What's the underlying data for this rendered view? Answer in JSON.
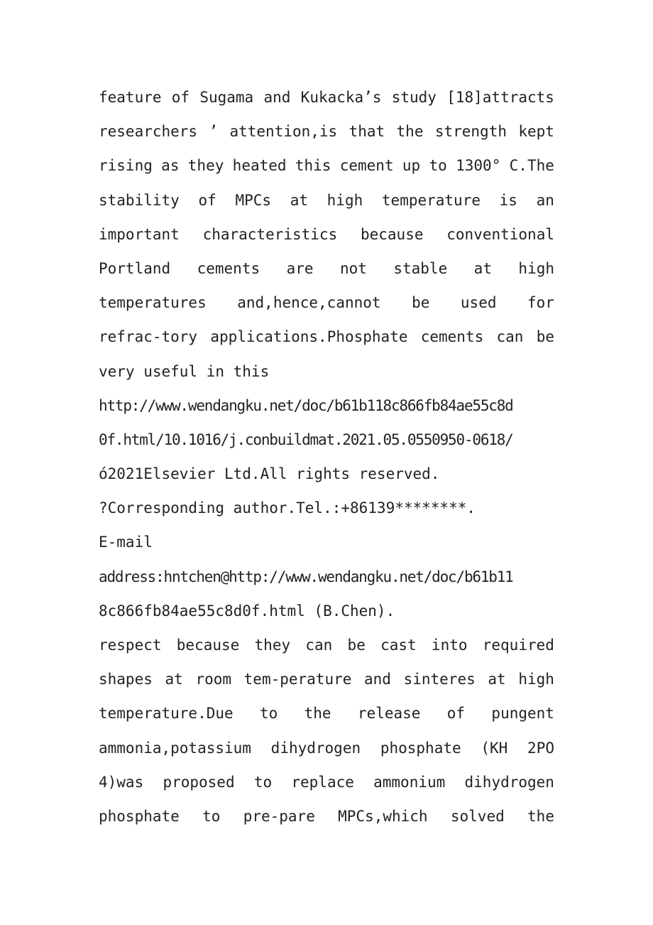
{
  "document": {
    "lines": [
      {
        "align": "justify",
        "text": "feature of Sugama and Kukacka’s study [18]attracts"
      },
      {
        "align": "justify",
        "text": "researchers ’ attention,is that the strength kept"
      },
      {
        "align": "justify",
        "text": "rising as they heated this cement up to 1300° C.The"
      },
      {
        "align": "justify",
        "text": "stability of MPCs at high temperature is an"
      },
      {
        "align": "justify",
        "text": "important characteristics because conventional"
      },
      {
        "align": "justify",
        "text": "Portland cements are not stable at high"
      },
      {
        "align": "justify",
        "text": "temperatures and,hence,cannot be used for"
      },
      {
        "align": "justify",
        "text": "refrac-tory applications.Phosphate cements can be"
      },
      {
        "align": "left",
        "text": "very useful in this"
      },
      {
        "align": "left",
        "text": "http://www.wendangku.net/doc/b61b118c866fb84ae55c8d"
      },
      {
        "align": "left",
        "text": "0f.html/10.1016/j.conbuildmat.2021.05.0550950-0618/"
      },
      {
        "align": "left",
        "text": "ó2021Elsevier Ltd.All rights reserved."
      },
      {
        "align": "left",
        "text": "?Corresponding author.Tel.:+86139********."
      },
      {
        "align": "left",
        "text": "E-mail"
      },
      {
        "align": "left",
        "text": "address:hntchen@http://www.wendangku.net/doc/b61b11"
      },
      {
        "align": "left",
        "text": "8c866fb84ae55c8d0f.html (B.Chen)."
      },
      {
        "align": "justify",
        "text": "respect because they can be cast into required"
      },
      {
        "align": "justify",
        "text": "shapes at room tem-perature and sinteres at high"
      },
      {
        "align": "justify",
        "text": "temperature.Due to the release of pungent"
      },
      {
        "align": "justify",
        "text": "ammonia,potassium dihydrogen phosphate (KH 2PO"
      },
      {
        "align": "justify",
        "text": "4)was proposed to replace ammonium dihydrogen"
      },
      {
        "align": "justify",
        "text": "phosphate to pre-pare MPCs,which solved the"
      }
    ]
  }
}
